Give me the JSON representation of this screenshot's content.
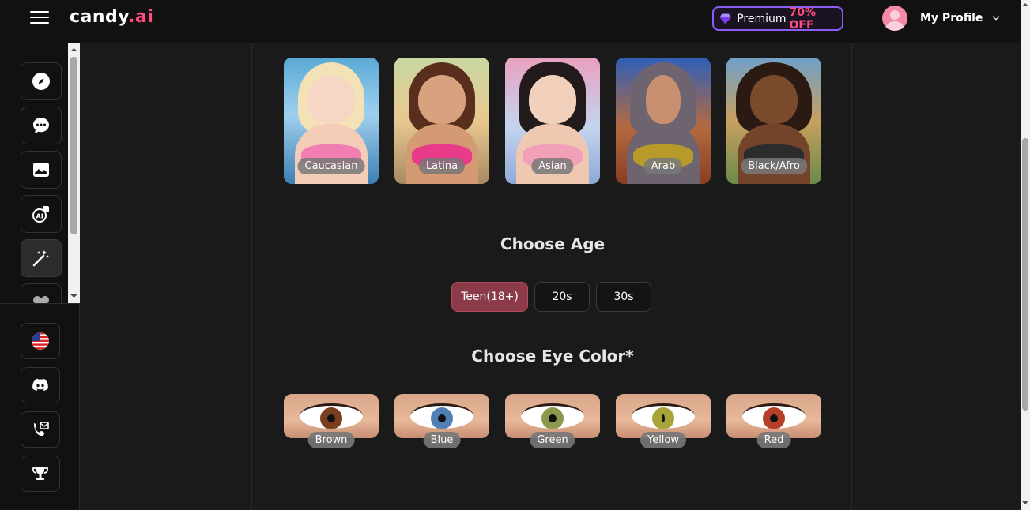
{
  "header": {
    "logo_main": "candy",
    "logo_suffix": ".ai",
    "premium_label": "Premium",
    "premium_discount": "70% OFF",
    "profile_label": "My Profile"
  },
  "sidebar": {
    "top_items": [
      {
        "icon": "compass-icon"
      },
      {
        "icon": "chat-icon"
      },
      {
        "icon": "image-icon"
      },
      {
        "icon": "ai-generate-icon"
      },
      {
        "icon": "magic-wand-icon",
        "active": true
      },
      {
        "icon": "heart-icon"
      }
    ],
    "bottom_items": [
      {
        "icon": "us-flag-icon"
      },
      {
        "icon": "discord-icon"
      },
      {
        "icon": "support-icon"
      },
      {
        "icon": "trophy-icon"
      }
    ]
  },
  "ethnicity": [
    {
      "label": "Caucasian"
    },
    {
      "label": "Latina"
    },
    {
      "label": "Asian"
    },
    {
      "label": "Arab"
    },
    {
      "label": "Black/Afro"
    }
  ],
  "age": {
    "title": "Choose Age",
    "options": [
      "Teen(18+)",
      "20s",
      "30s"
    ],
    "selected": "Teen(18+)"
  },
  "eye_color": {
    "title": "Choose Eye Color*",
    "options": [
      {
        "label": "Brown",
        "color": "#7a3d1e"
      },
      {
        "label": "Blue",
        "color": "#4f7fb5"
      },
      {
        "label": "Green",
        "color": "#8a9a4a"
      },
      {
        "label": "Yellow",
        "color": "#a9a43a"
      },
      {
        "label": "Red",
        "color": "#b5402a"
      }
    ]
  },
  "colors": {
    "accent_pink": "#ff4d7d",
    "premium_border": "#8b5cf6",
    "age_selected": "#8a3a48"
  }
}
